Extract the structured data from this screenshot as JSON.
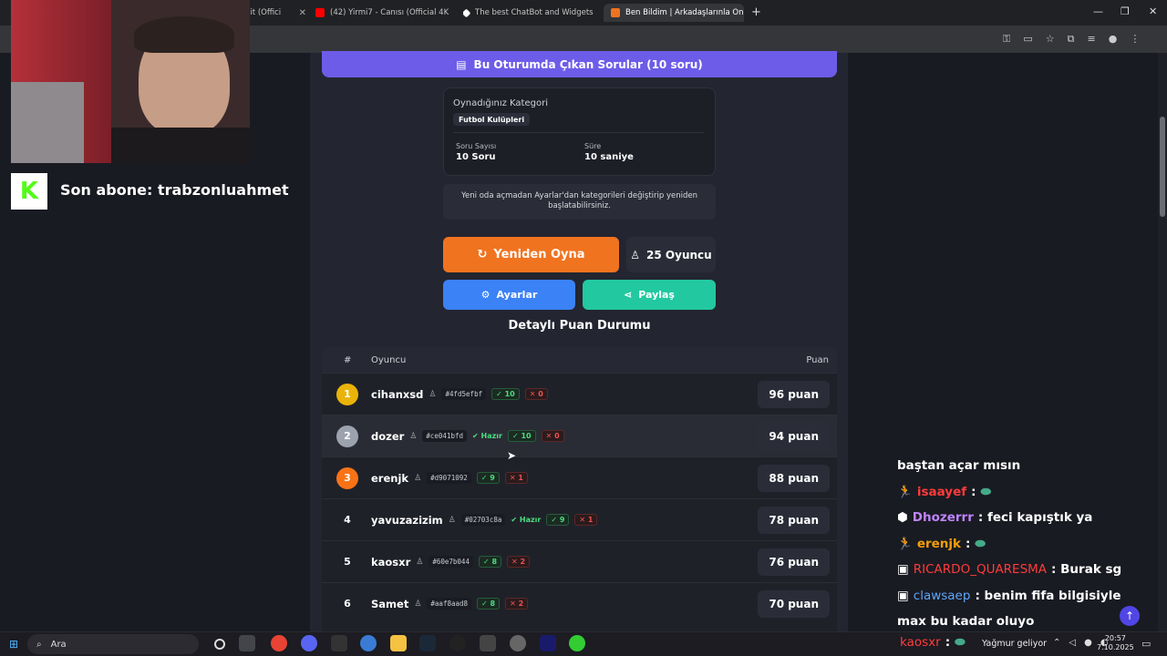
{
  "browser": {
    "tabs": [
      {
        "label": "şit (Offici",
        "color": "#ff0000"
      },
      {
        "label": "(42) Yirmi7 - Canısı (Official 4K",
        "color": "#ff0000"
      },
      {
        "label": "The best ChatBot and Widgets",
        "color": "#ffffff"
      },
      {
        "label": "Ben Bildim | Arkadaşlarınla Onli",
        "color": "#f07320"
      }
    ],
    "new_tab": "+",
    "close": "✕"
  },
  "stream": {
    "subscriber_label": "Son abone: trabzonluahmet",
    "logo_letter": "K"
  },
  "game": {
    "top_button": "Bu Oturumda Çıkan Sorular (10 soru)",
    "category_label": "Oynadığınız Kategori",
    "category_value": "Futbol Kulüpleri",
    "question_count_label": "Soru Sayısı",
    "question_count_value": "10 Soru",
    "duration_label": "Süre",
    "duration_value": "10 saniye",
    "note": "Yeni oda açmadan Ayarlar'dan kategorileri değiştirip yeniden başlatabilirsiniz.",
    "replay_button": "Yeniden Oyna",
    "players_button": "25 Oyuncu",
    "settings_button": "Ayarlar",
    "share_button": "Paylaş",
    "scoreboard_title": "Detaylı Puan Durumu",
    "columns": {
      "rank": "#",
      "player": "Oyuncu",
      "score": "Puan"
    },
    "rows": [
      {
        "rank": "1",
        "name": "cihanxsd",
        "id": "#4fd5efbf",
        "ready": "",
        "correct": "10",
        "wrong": "0",
        "score": "96 puan",
        "rank_color": "#eab308"
      },
      {
        "rank": "2",
        "name": "dozer",
        "id": "#ce041bfd",
        "ready": "Hazır",
        "correct": "10",
        "wrong": "0",
        "score": "94 puan",
        "rank_color": "#9ca3af"
      },
      {
        "rank": "3",
        "name": "erenjk",
        "id": "#d9071092",
        "ready": "",
        "correct": "9",
        "wrong": "1",
        "score": "88 puan",
        "rank_color": "#f97316"
      },
      {
        "rank": "4",
        "name": "yavuzazizim",
        "id": "#02703c8a",
        "ready": "Hazır",
        "correct": "9",
        "wrong": "1",
        "score": "78 puan",
        "rank_color": ""
      },
      {
        "rank": "5",
        "name": "kaosxr",
        "id": "#60e7b044",
        "ready": "",
        "correct": "8",
        "wrong": "2",
        "score": "76 puan",
        "rank_color": ""
      },
      {
        "rank": "6",
        "name": "Samet",
        "id": "#aaf8aad8",
        "ready": "",
        "correct": "8",
        "wrong": "2",
        "score": "70 puan",
        "rank_color": ""
      }
    ]
  },
  "chat": [
    {
      "user": "",
      "user_color": "#ffffff",
      "message": "baştan açar mısın"
    },
    {
      "user": "isaayef",
      "user_color": "#ff3b3b",
      "message": ":"
    },
    {
      "user": "Dhozerrr",
      "user_color": "#c084fc",
      "message": ": feci kapıştık ya"
    },
    {
      "user": "erenjk",
      "user_color": "#f59e0b",
      "message": ":"
    },
    {
      "user": "RICARDO_QUARESMA",
      "user_color": "#ff3b3b",
      "message": ": Burak sg"
    },
    {
      "user": "clawsaep",
      "user_color": "#60a5fa",
      "message": ": benim fifa bilgisiyle"
    },
    {
      "user": "",
      "user_color": "#ffffff",
      "message": "max bu kadar oluyo"
    },
    {
      "user": "kaosxr",
      "user_color": "#ff3b3b",
      "message": ":"
    }
  ],
  "taskbar": {
    "search_label": "Ara",
    "weather": "Yağmur geliyor",
    "time": "20:57",
    "date": "7.10.2025"
  }
}
